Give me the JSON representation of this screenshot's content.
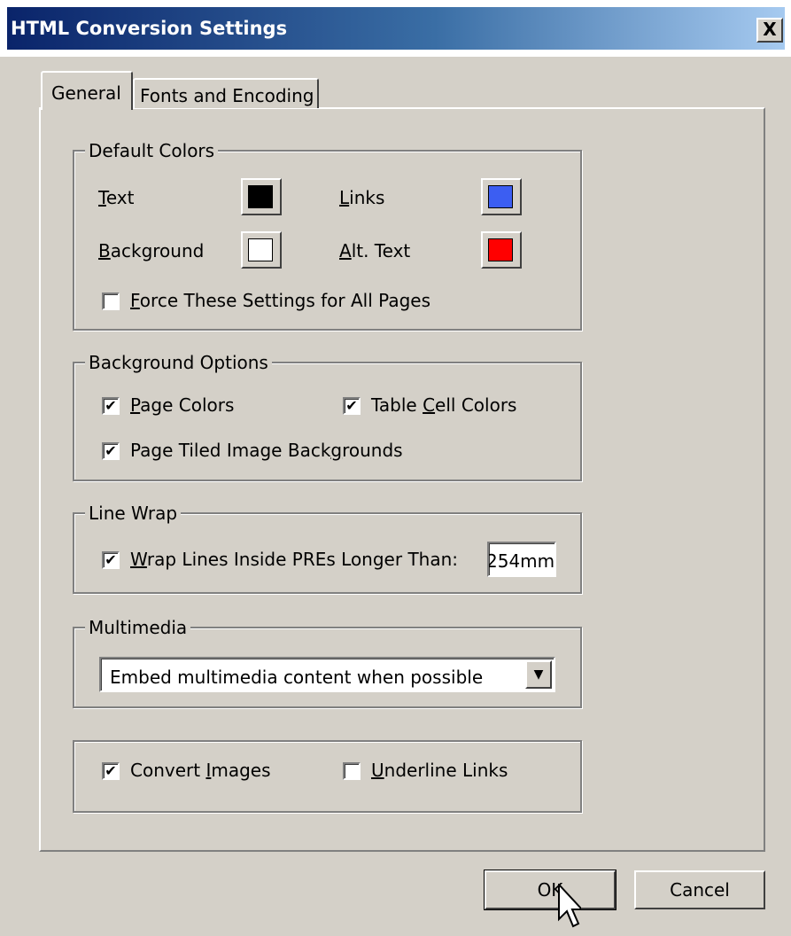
{
  "window": {
    "title": "HTML Conversion Settings",
    "close_label": "X"
  },
  "tabs": [
    {
      "label": "General"
    },
    {
      "label": "Fonts and Encoding"
    }
  ],
  "default_colors": {
    "legend": "Default Colors",
    "text": {
      "label_pre": "",
      "label_acc": "T",
      "label_post": "ext",
      "color": "#000000"
    },
    "links": {
      "label_pre": "",
      "label_acc": "L",
      "label_post": "inks",
      "color": "#3c5ef2"
    },
    "background": {
      "label_pre": "",
      "label_acc": "B",
      "label_post": "ackground",
      "color": "#ffffff"
    },
    "alt_text": {
      "label_pre": "",
      "label_acc": "A",
      "label_post": "lt. Text",
      "color": "#ff0000"
    },
    "force": {
      "label_pre": "",
      "label_acc": "F",
      "label_post": "orce These Settings for All Pages",
      "checked": false
    }
  },
  "background_options": {
    "legend": "Background Options",
    "page_colors": {
      "label_pre": "",
      "label_acc": "P",
      "label_post": "age Colors",
      "checked": true
    },
    "table_cell_colors": {
      "label_pre": "Table ",
      "label_acc": "C",
      "label_post": "ell Colors",
      "checked": true
    },
    "tiled_images": {
      "label_pre": "Page Tiled Image Back",
      "label_acc": "g",
      "label_post": "rounds",
      "checked": true
    }
  },
  "line_wrap": {
    "legend": "Line Wrap",
    "wrap": {
      "label_pre": "",
      "label_acc": "W",
      "label_post": "rap Lines Inside PREs Longer Than:",
      "checked": true
    },
    "value": "254mm"
  },
  "multimedia": {
    "legend": "Multimedia",
    "selected": "Embed multimedia content when possible"
  },
  "misc": {
    "convert_images": {
      "label_pre": "Convert ",
      "label_acc": "I",
      "label_post": "mages",
      "checked": true
    },
    "underline_links": {
      "label_pre": "",
      "label_acc": "U",
      "label_post": "nderline Links",
      "checked": false
    }
  },
  "buttons": {
    "ok": "OK",
    "cancel": "Cancel"
  },
  "check_mark": "✔"
}
